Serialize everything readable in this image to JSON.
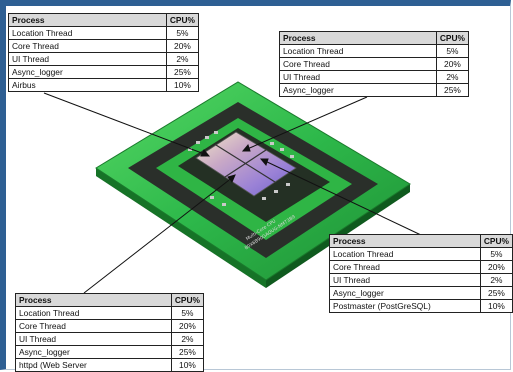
{
  "headers": {
    "process": "Process",
    "cpu": "CPU%"
  },
  "chip_label": {
    "line1": "Multi-Core CPU",
    "line2": "80X6B90GAOUG-NM73B9"
  },
  "tables": [
    {
      "rows": [
        {
          "process": "Location Thread",
          "cpu": "5%"
        },
        {
          "process": "Core Thread",
          "cpu": "20%"
        },
        {
          "process": "UI Thread",
          "cpu": "2%"
        },
        {
          "process": "Async_logger",
          "cpu": "25%"
        },
        {
          "process": "Airbus",
          "cpu": "10%"
        }
      ]
    },
    {
      "rows": [
        {
          "process": "Location Thread",
          "cpu": "5%"
        },
        {
          "process": "Core Thread",
          "cpu": "20%"
        },
        {
          "process": "UI Thread",
          "cpu": "2%"
        },
        {
          "process": "Async_logger",
          "cpu": "25%"
        }
      ]
    },
    {
      "rows": [
        {
          "process": "Location Thread",
          "cpu": "5%"
        },
        {
          "process": "Core Thread",
          "cpu": "20%"
        },
        {
          "process": "UI Thread",
          "cpu": "2%"
        },
        {
          "process": "Async_logger",
          "cpu": "25%"
        },
        {
          "process": "Postmaster (PostGreSQL)",
          "cpu": "10%"
        }
      ]
    },
    {
      "rows": [
        {
          "process": "Location Thread",
          "cpu": "5%"
        },
        {
          "process": "Core Thread",
          "cpu": "20%"
        },
        {
          "process": "UI Thread",
          "cpu": "2%"
        },
        {
          "process": "Async_logger",
          "cpu": "25%"
        },
        {
          "process": "httpd (Web Server",
          "cpu": "10%"
        }
      ]
    }
  ],
  "colors": {
    "frame": "#2e5f93",
    "board_green": "#2db84a",
    "board_dark": "#1d6b2c",
    "chip_dark": "#2a2f2a"
  }
}
